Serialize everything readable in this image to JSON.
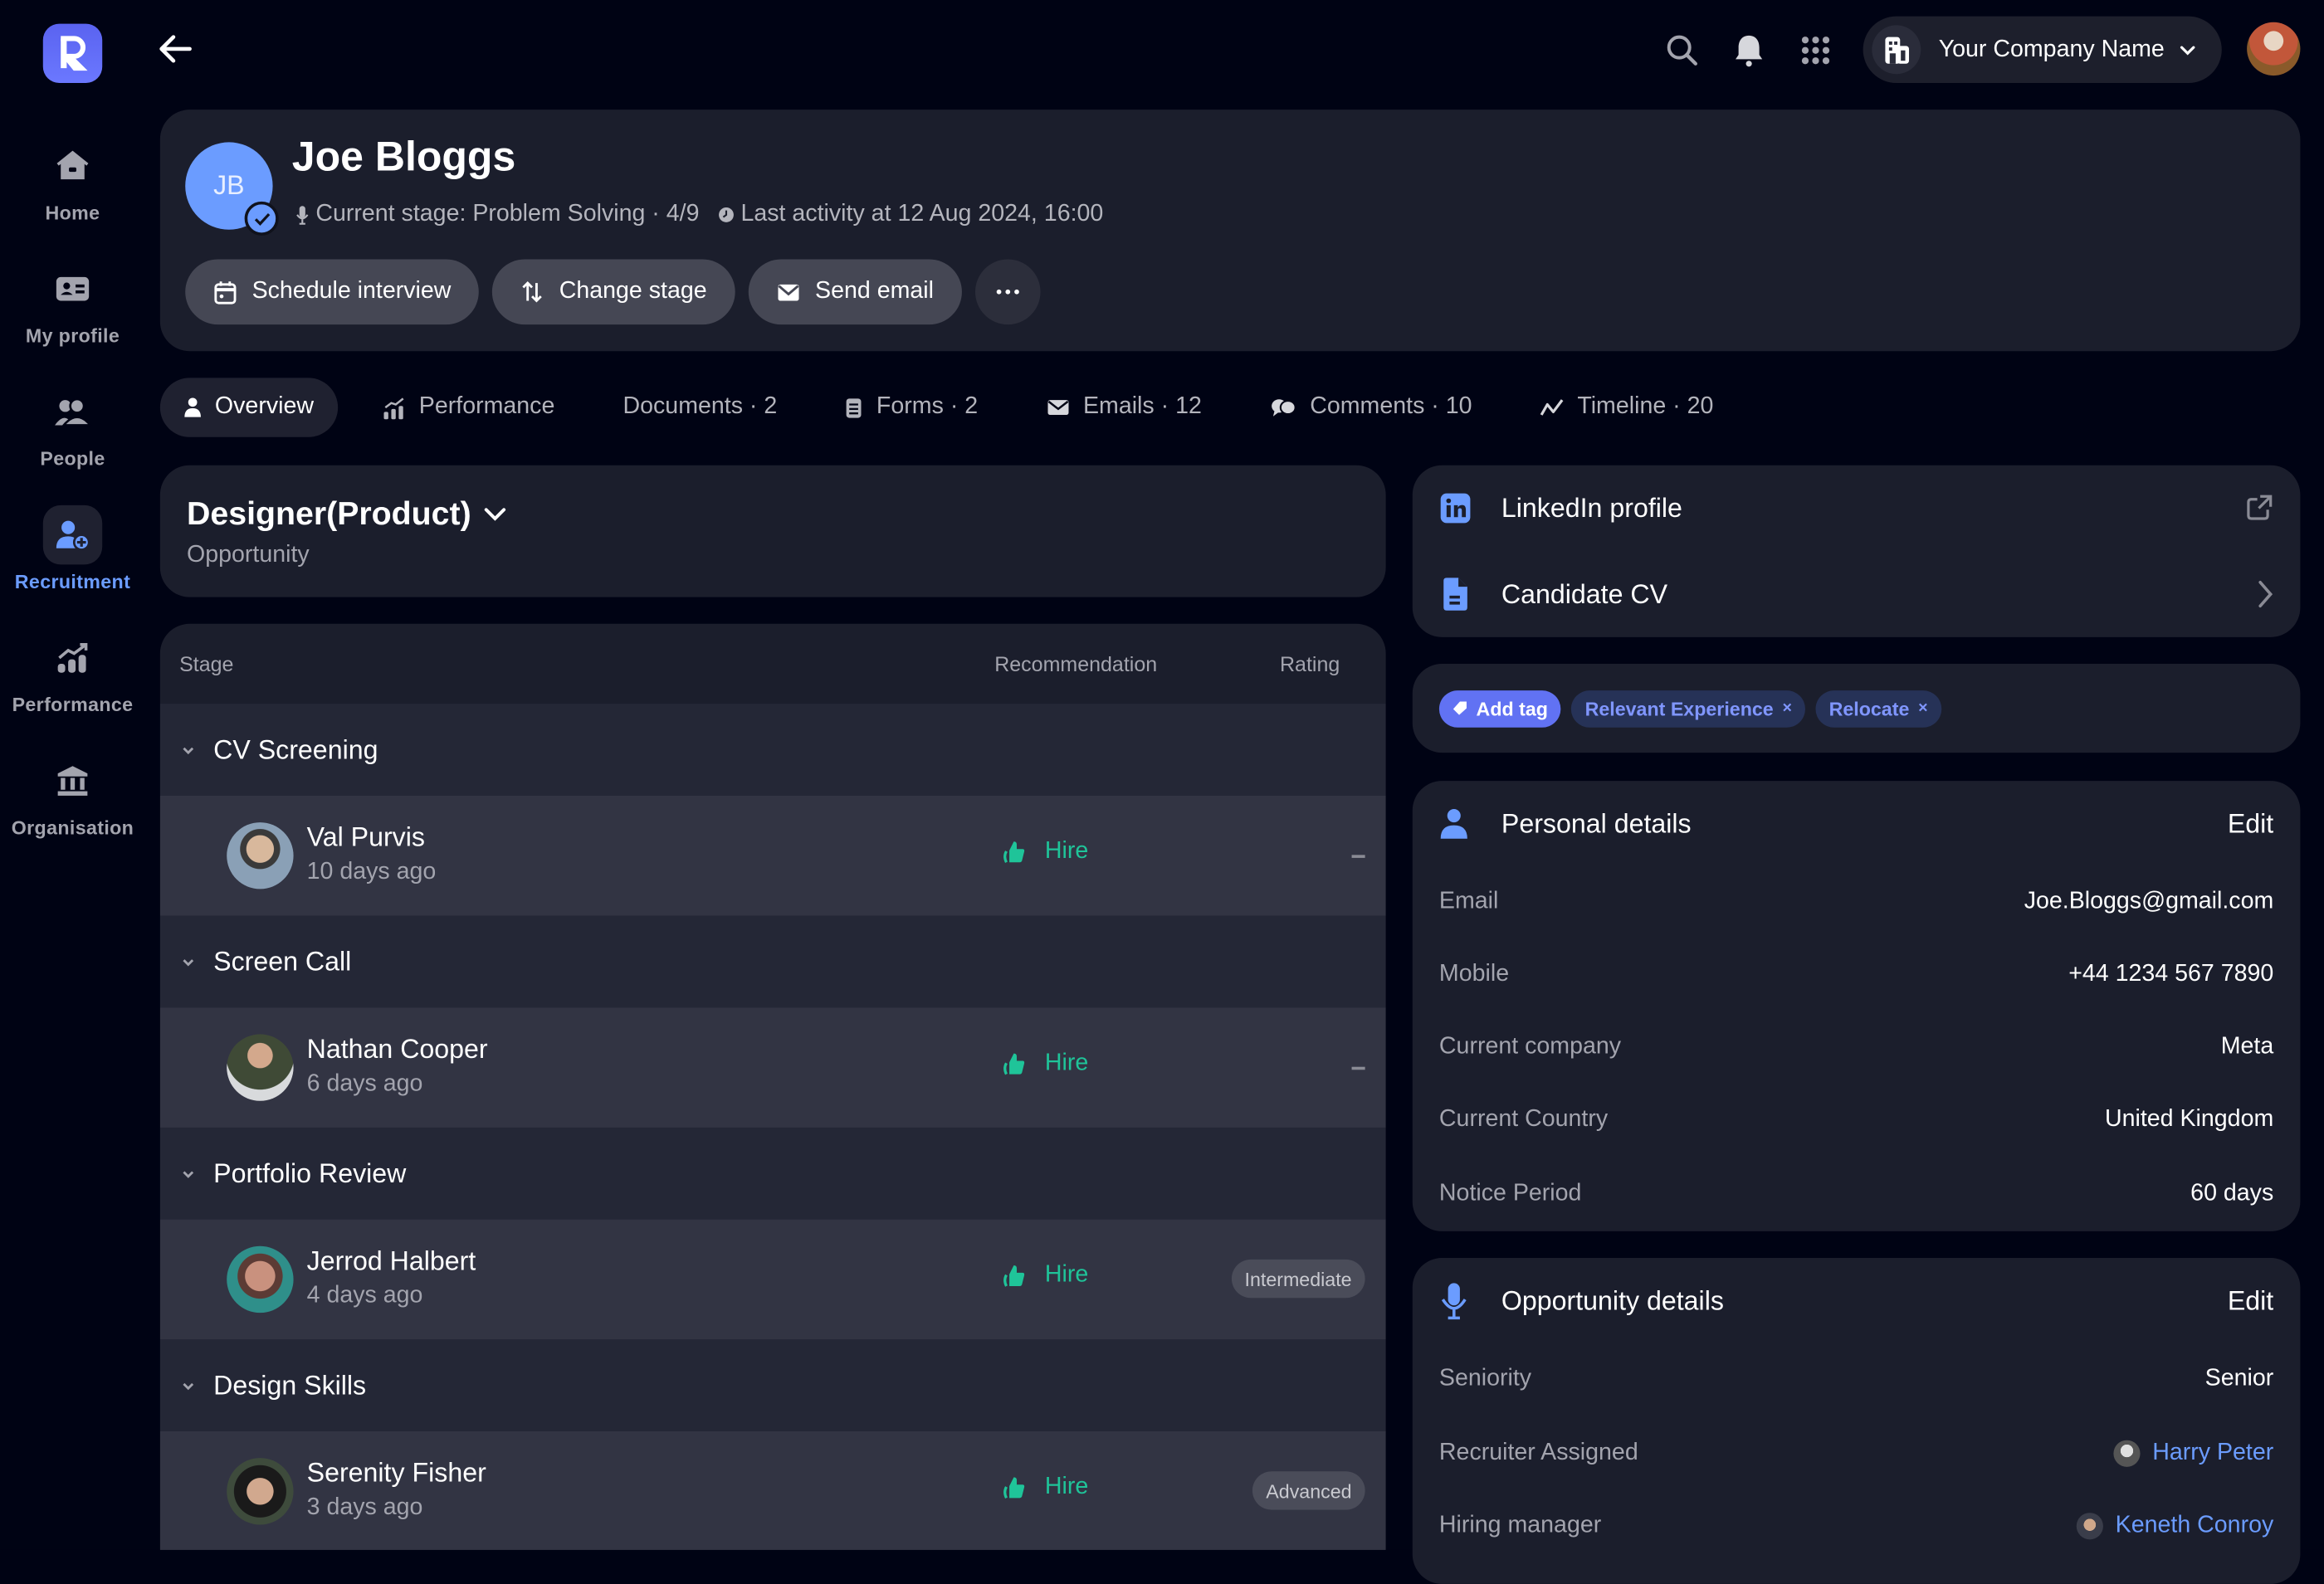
{
  "app": {
    "logo_letter": "R",
    "company": "Your Company Name"
  },
  "sidebar": {
    "items": [
      {
        "label": "Home",
        "icon": "home-icon",
        "active": false
      },
      {
        "label": "My profile",
        "icon": "id-card-icon",
        "active": false
      },
      {
        "label": "People",
        "icon": "people-icon",
        "active": false
      },
      {
        "label": "Recruitment",
        "icon": "add-user-icon",
        "active": true
      },
      {
        "label": "Performance",
        "icon": "chart-icon",
        "active": false
      },
      {
        "label": "Organisation",
        "icon": "building-icon",
        "active": false
      }
    ]
  },
  "candidate": {
    "initials": "JB",
    "name": "Joe Bloggs",
    "current_stage": "Current stage: Problem Solving · 4/9",
    "last_activity": "Last activity at 12 Aug 2024, 16:00",
    "actions": {
      "schedule": "Schedule interview",
      "change_stage": "Change stage",
      "send_email": "Send email"
    }
  },
  "tabs": [
    {
      "label": "Overview",
      "active": true
    },
    {
      "label": "Performance",
      "active": false
    },
    {
      "label": "Documents · 2",
      "active": false
    },
    {
      "label": "Forms · 2",
      "active": false
    },
    {
      "label": "Emails · 12",
      "active": false
    },
    {
      "label": "Comments · 10",
      "active": false
    },
    {
      "label": "Timeline · 20",
      "active": false
    }
  ],
  "opportunity": {
    "title": "Designer(Product)",
    "subtitle": "Opportunity"
  },
  "stages_table": {
    "headers": {
      "stage": "Stage",
      "recommendation": "Recommendation",
      "rating": "Rating"
    },
    "groups": [
      {
        "name": "CV Screening",
        "reviewer": "Val Purvis",
        "ago": "10 days ago",
        "recommendation": "Hire",
        "rating": "–"
      },
      {
        "name": "Screen Call",
        "reviewer": "Nathan Cooper",
        "ago": "6 days ago",
        "recommendation": "Hire",
        "rating": "–"
      },
      {
        "name": "Portfolio Review",
        "reviewer": "Jerrod Halbert",
        "ago": "4 days ago",
        "recommendation": "Hire",
        "rating": "Intermediate"
      },
      {
        "name": "Design Skills",
        "reviewer": "Serenity Fisher",
        "ago": "3 days ago",
        "recommendation": "Hire",
        "rating": "Advanced"
      }
    ]
  },
  "links": {
    "linkedin": "LinkedIn profile",
    "cv": "Candidate CV"
  },
  "tags": {
    "add_label": "Add tag",
    "items": [
      "Relevant Experience",
      "Relocate"
    ]
  },
  "personal_details": {
    "title": "Personal details",
    "edit": "Edit",
    "rows": [
      {
        "label": "Email",
        "value": "Joe.Bloggs@gmail.com"
      },
      {
        "label": "Mobile",
        "value": "+44 1234 567 7890"
      },
      {
        "label": "Current company",
        "value": "Meta"
      },
      {
        "label": "Current Country",
        "value": "United Kingdom"
      },
      {
        "label": "Notice Period",
        "value": "60 days"
      }
    ]
  },
  "opportunity_details": {
    "title": "Opportunity details",
    "edit": "Edit",
    "rows": [
      {
        "label": "Seniority",
        "value": "Senior"
      },
      {
        "label": "Recruiter Assigned",
        "value": "Harry Peter"
      },
      {
        "label": "Hiring manager",
        "value": "Keneth Conroy"
      }
    ]
  },
  "colors": {
    "background": "#000314",
    "card": "#1b1e2c",
    "accent_blue": "#6b9cff",
    "brand": "#5a63f0",
    "hire_green": "#1fc499"
  }
}
